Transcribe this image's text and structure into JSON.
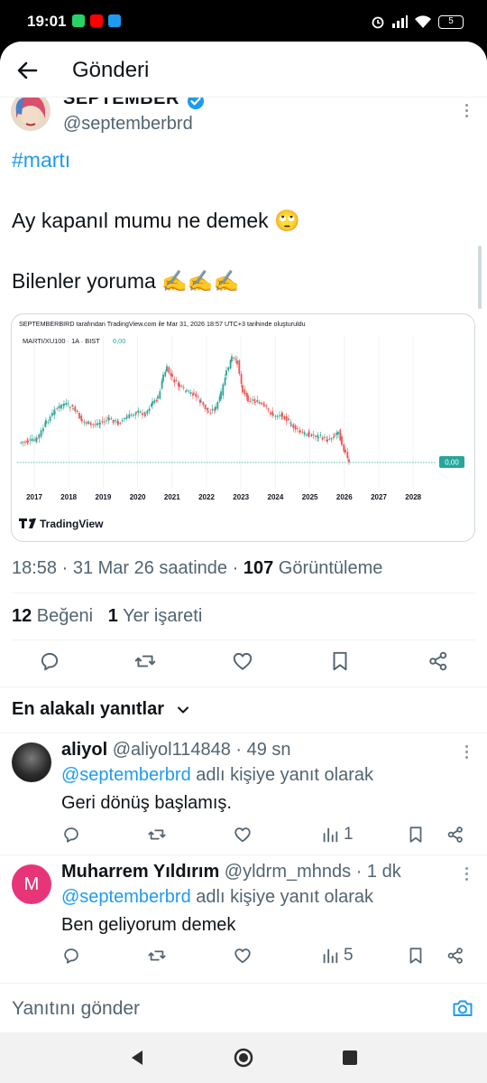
{
  "status_bar": {
    "time": "19:01",
    "battery": "5"
  },
  "header": {
    "title": "Gönderi"
  },
  "post": {
    "author_name": "SEPTEMBER",
    "author_handle": "@septemberbrd",
    "hashtag": "#martı",
    "line1": "Ay kapanıl mumu ne demek 🙄",
    "line2": "Bilenler yoruma ✍️✍️✍️",
    "timestamp": "18:58 · 31 Mar 26 saatinde · ",
    "views_count": "107",
    "views_label": " Görüntüleme",
    "likes_count": "12",
    "likes_label": " Beğeni",
    "bookmarks_count": "1",
    "bookmarks_label": " Yer işareti"
  },
  "chart_image": {
    "caption": "SEPTEMBERBIRD tarafından TradingView.com ile Mar 31, 2026 18:57 UTC+3 tarihinde oluşturuldu",
    "symbol": "MARTI/XU100 · 1A · BIST",
    "symbol_value": "0,00",
    "last_price_tag": "0,00",
    "brand": "TradingView",
    "up_color": "#26a69a",
    "down_color": "#ef5350"
  },
  "chart_data": {
    "type": "candlestick",
    "title": "MARTI/XU100 · 1A · BIST",
    "x_tick_labels": [
      "2017",
      "2018",
      "2019",
      "2020",
      "2021",
      "2022",
      "2023",
      "2024",
      "2025",
      "2026",
      "2027",
      "2028"
    ],
    "series_shape": "Monthly ratio rises from 2017 to peaks near early 2021 and late 2022, then declines steadily to near its lows by 2026; values not printed on the chart",
    "last_value_label": "0,00"
  },
  "sort": {
    "label": "En alakalı yanıtlar"
  },
  "replies": [
    {
      "name": "aliyol",
      "handle": "@aliyol114848",
      "time": " · 49 sn",
      "reply_prefix": "@septemberbrd",
      "reply_suffix": " adlı kişiye yanıt olarak",
      "text": "Geri dönüş başlamış.",
      "views": "1"
    },
    {
      "name": "Muharrem Yıldırım",
      "handle": "@yldrm_mhnds",
      "time": " · 1 dk",
      "reply_prefix": "@septemberbrd",
      "reply_suffix": " adlı kişiye yanıt olarak",
      "text": "Ben geliyorum demek",
      "views": "5",
      "avatar_letter": "M",
      "avatar_color": "#e8357a"
    }
  ],
  "composer": {
    "placeholder": "Yanıtını gönder"
  }
}
